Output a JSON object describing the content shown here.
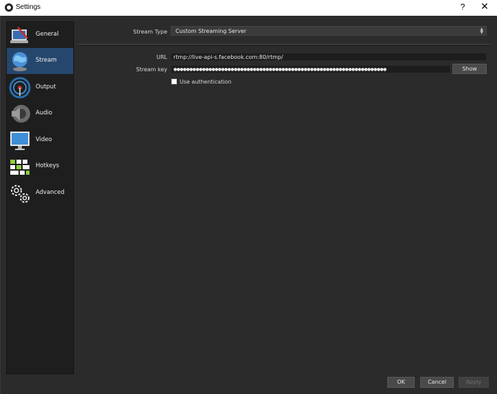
{
  "window": {
    "title": "Settings",
    "help": "?",
    "close": "✕"
  },
  "sidebar": {
    "items": [
      {
        "label": "General",
        "icon": "general-icon",
        "selected": false
      },
      {
        "label": "Stream",
        "icon": "stream-globe-icon",
        "selected": true
      },
      {
        "label": "Output",
        "icon": "output-icon",
        "selected": false
      },
      {
        "label": "Audio",
        "icon": "speaker-icon",
        "selected": false
      },
      {
        "label": "Video",
        "icon": "monitor-icon",
        "selected": false
      },
      {
        "label": "Hotkeys",
        "icon": "keyboard-icon",
        "selected": false
      },
      {
        "label": "Advanced",
        "icon": "gears-icon",
        "selected": false
      }
    ]
  },
  "stream": {
    "type_label": "Stream Type",
    "type_value": "Custom Streaming Server",
    "url_label": "URL",
    "url_value": "rtmp://live-api-s.facebook.com:80/rtmp/",
    "key_label": "Stream key",
    "key_value": "●●●●●●●●●●●●●●●●●●●●●●●●●●●●●●●●●●●●●●●●●●●●●●●●●●●●●●●●●●●●●●●●●●●",
    "show_button": "Show",
    "auth_label": "Use authentication",
    "auth_checked": false
  },
  "footer": {
    "ok": "OK",
    "cancel": "Cancel",
    "apply": "Apply"
  },
  "colors": {
    "selected": "#26476d",
    "background": "#2b2b2b",
    "sidebar": "#1e1e1e"
  }
}
